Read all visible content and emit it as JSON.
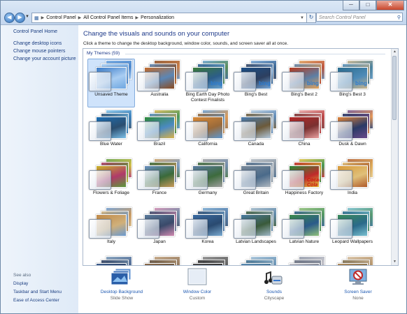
{
  "window": {
    "min": "─",
    "max": "□",
    "close": "✕"
  },
  "address": {
    "segments": [
      "Control Panel",
      "All Control Panel Items",
      "Personalization"
    ]
  },
  "search": {
    "placeholder": "Search Control Panel"
  },
  "sidebar": {
    "home": "Control Panel Home",
    "links": [
      "Change desktop icons",
      "Change mouse pointers",
      "Change your account picture"
    ],
    "see_also": "See also",
    "see_also_links": [
      "Display",
      "Taskbar and Start Menu",
      "Ease of Access Center"
    ]
  },
  "main": {
    "heading": "Change the visuals and sounds on your computer",
    "subheading": "Click a theme to change the desktop background, window color, sounds, and screen saver all at once.",
    "group": "My Themes (59)"
  },
  "themes": [
    {
      "label": "Unsaved Theme",
      "selected": true,
      "colors": [
        "#3a7bc8",
        "#6ea6e0",
        "#a9cdf2"
      ]
    },
    {
      "label": "Australia",
      "colors": [
        "#c46a2a",
        "#8c4a1e",
        "#5b86b5"
      ]
    },
    {
      "label": "Bing Earth Day Photo Contest Finalists",
      "badge": "bing",
      "colors": [
        "#3b7a3a",
        "#6aa3cf",
        "#2c5d8a"
      ]
    },
    {
      "label": "Bing's Best",
      "badge": "bing",
      "colors": [
        "#1c4f86",
        "#78a8d8",
        "#2d3f5f"
      ]
    },
    {
      "label": "Bing's Best 2",
      "badge": "bing",
      "colors": [
        "#b83a1e",
        "#e3a25a",
        "#5d7fa5"
      ]
    },
    {
      "label": "Bing's Best 3",
      "badge": "bing",
      "colors": [
        "#2d6e8f",
        "#c9b48a",
        "#4e8bb8"
      ]
    },
    {
      "label": "Blue Water",
      "colors": [
        "#1e6fb3",
        "#7cc0e8",
        "#2b4e70"
      ]
    },
    {
      "label": "Brazil",
      "colors": [
        "#2f8a3a",
        "#d7b24a",
        "#4b8ac2"
      ]
    },
    {
      "label": "California",
      "colors": [
        "#d88a3a",
        "#5d97cf",
        "#9a6a3a"
      ]
    },
    {
      "label": "Canada",
      "colors": [
        "#4a7cb0",
        "#b2c9de",
        "#6c5a3a"
      ]
    },
    {
      "label": "China",
      "colors": [
        "#b52a2a",
        "#e8a0a0",
        "#7a3030"
      ]
    },
    {
      "label": "Dusk & Dawn",
      "colors": [
        "#e0843a",
        "#6a4a8a",
        "#2a3a66"
      ]
    },
    {
      "label": "Flowers & Foliage",
      "colors": [
        "#c8b42a",
        "#5a9a3a",
        "#b03a6a"
      ]
    },
    {
      "label": "France",
      "colors": [
        "#6a8fc0",
        "#c89a5a",
        "#3a6a3a"
      ]
    },
    {
      "label": "Germany",
      "colors": [
        "#5a7aa0",
        "#a0a0a0",
        "#3d6b3d"
      ]
    },
    {
      "label": "Great Britain",
      "colors": [
        "#7a8a9a",
        "#b0b8c0",
        "#4a6a8a"
      ]
    },
    {
      "label": "Happiness Factory",
      "badge": "Coca-Cola",
      "colors": [
        "#2a8a3a",
        "#e0c03a",
        "#c02a2a"
      ]
    },
    {
      "label": "India",
      "colors": [
        "#d89a3a",
        "#b05a2a",
        "#e0c07a"
      ]
    },
    {
      "label": "Italy",
      "colors": [
        "#c08a4a",
        "#6a9ad0",
        "#d0b07a"
      ]
    },
    {
      "label": "Japan",
      "colors": [
        "#5a7a9a",
        "#d08ab0",
        "#3a4a6a"
      ]
    },
    {
      "label": "Korea",
      "colors": [
        "#3a6aa0",
        "#7aaad0",
        "#2a4a70"
      ]
    },
    {
      "label": "Latvian Landscapes",
      "colors": [
        "#4a7aa0",
        "#a0b8c8",
        "#3a5a3a"
      ]
    },
    {
      "label": "Latvian Nature",
      "colors": [
        "#3a8a4a",
        "#90c07a",
        "#2a5a8a"
      ]
    },
    {
      "label": "Leopard Wallpapers",
      "colors": [
        "#3a8a5a",
        "#7ac0d0",
        "#2a6a8a"
      ]
    },
    {
      "label": "",
      "colors": [
        "#3a5a8a",
        "#7a9ab8",
        "#2a3a5a"
      ]
    },
    {
      "label": "",
      "colors": [
        "#8a6a4a",
        "#c0a07a",
        "#5a4a3a"
      ]
    },
    {
      "label": "",
      "colors": [
        "#4a4a4a",
        "#8a8a8a",
        "#2a2a2a"
      ]
    },
    {
      "label": "",
      "colors": [
        "#5a8ab0",
        "#a0c0d8",
        "#3a6a8a"
      ]
    },
    {
      "label": "",
      "colors": [
        "#c0c0c8",
        "#9098a8",
        "#6a7080"
      ]
    },
    {
      "label": "",
      "colors": [
        "#b08a5a",
        "#d8c0a0",
        "#7a6a4a"
      ]
    }
  ],
  "bottom": [
    {
      "name": "Desktop Background",
      "value": "Slide Show",
      "icon": "desktop-background-icon"
    },
    {
      "name": "Window Color",
      "value": "Custom",
      "icon": "window-color-icon"
    },
    {
      "name": "Sounds",
      "value": "Cityscape",
      "icon": "sounds-icon"
    },
    {
      "name": "Screen Saver",
      "value": "None",
      "icon": "screen-saver-icon"
    }
  ]
}
